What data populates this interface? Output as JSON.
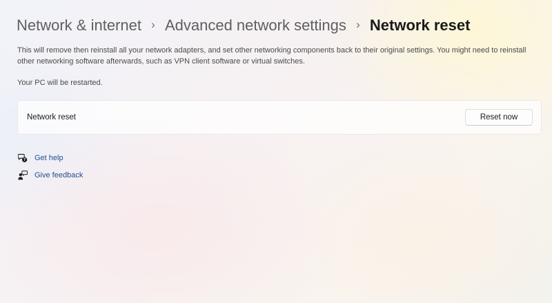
{
  "breadcrumb": {
    "items": [
      "Network & internet",
      "Advanced network settings",
      "Network reset"
    ],
    "separator": "›"
  },
  "description": "This will remove then reinstall all your network adapters, and set other networking components back to their original settings. You might need to reinstall other networking software afterwards, such as VPN client software or virtual switches.",
  "restart_note": "Your PC will be restarted.",
  "reset_card": {
    "label": "Network reset",
    "button_label": "Reset now"
  },
  "help_links": {
    "get_help": {
      "label": "Get help",
      "icon": "help-chat-icon"
    },
    "give_feedback": {
      "label": "Give feedback",
      "icon": "feedback-icon"
    }
  },
  "colors": {
    "link": "#1f4f8c",
    "breadcrumb_parent": "#5f5f5f",
    "breadcrumb_current": "#1a1a1a"
  }
}
